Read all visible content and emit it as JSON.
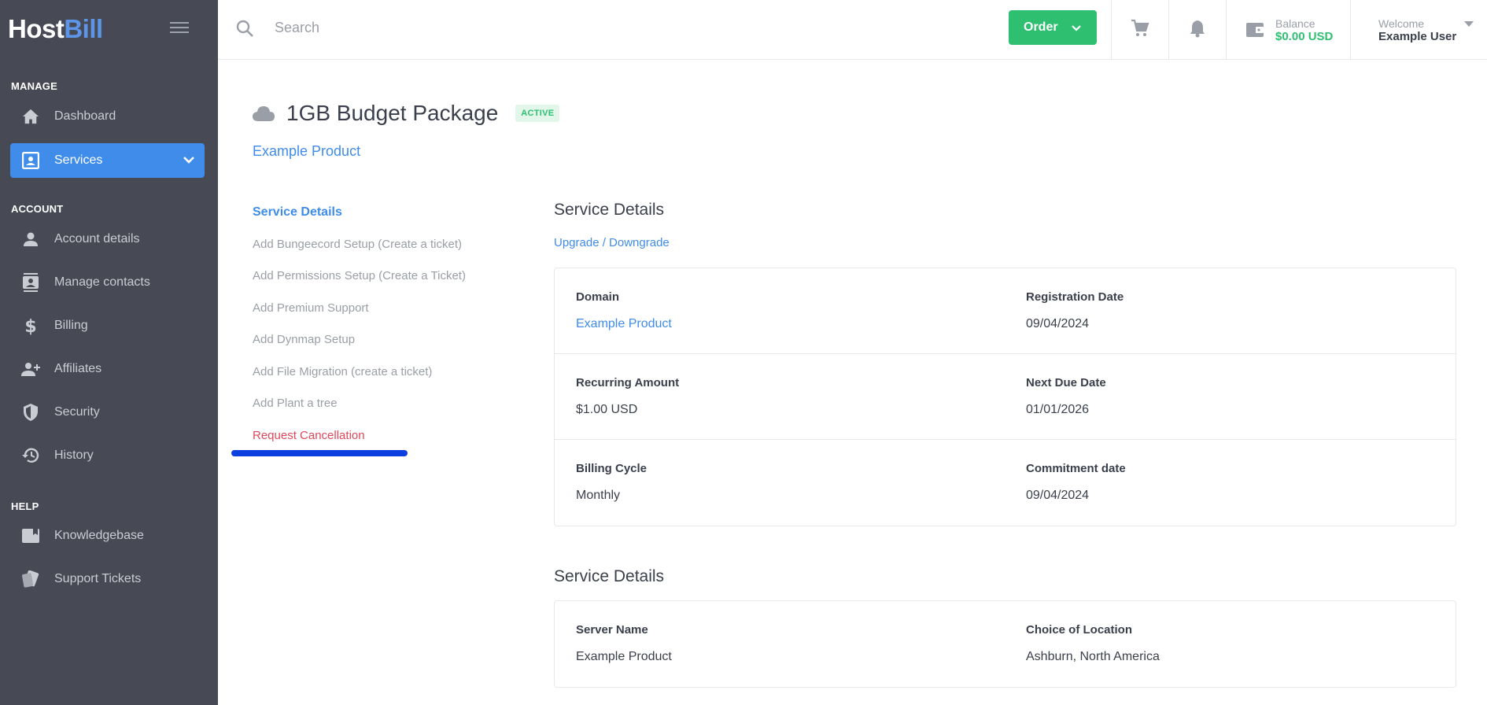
{
  "logo": {
    "host": "Host",
    "bill": "Bill"
  },
  "sidebar": {
    "sections": {
      "manage": "MANAGE",
      "account": "ACCOUNT",
      "help": "HELP"
    },
    "items": [
      {
        "label": "Dashboard",
        "icon": "home-icon"
      },
      {
        "label": "Services",
        "icon": "services-icon",
        "active": true
      },
      {
        "label": "Account details",
        "icon": "user-icon"
      },
      {
        "label": "Manage contacts",
        "icon": "contacts-icon"
      },
      {
        "label": "Billing",
        "icon": "dollar-icon"
      },
      {
        "label": "Affiliates",
        "icon": "affiliates-icon"
      },
      {
        "label": "Security",
        "icon": "shield-icon"
      },
      {
        "label": "History",
        "icon": "history-icon"
      },
      {
        "label": "Knowledgebase",
        "icon": "book-icon"
      },
      {
        "label": "Support Tickets",
        "icon": "tickets-icon"
      }
    ]
  },
  "topbar": {
    "search_placeholder": "Search",
    "order_label": "Order",
    "balance_label": "Balance",
    "balance_value": "$0.00 USD",
    "welcome_label": "Welcome",
    "user_name": "Example User"
  },
  "page": {
    "title": "1GB Budget Package",
    "status": "ACTIVE",
    "product_link": "Example Product"
  },
  "side_menu": [
    "Service Details",
    "Add Bungeecord Setup (Create a ticket)",
    "Add Permissions Setup (Create a Ticket)",
    "Add Premium Support",
    "Add Dynmap Setup",
    "Add File Migration (create a ticket)",
    "Add Plant a tree",
    "Request Cancellation"
  ],
  "details": {
    "title": "Service Details",
    "upgrade_link": "Upgrade / Downgrade",
    "rows": [
      {
        "l_label": "Domain",
        "l_value": "Example Product",
        "r_label": "Registration Date",
        "r_value": "09/04/2024"
      },
      {
        "l_label": "Recurring Amount",
        "l_value": "$1.00 USD",
        "r_label": "Next Due Date",
        "r_value": "01/01/2026"
      },
      {
        "l_label": "Billing Cycle",
        "l_value": "Monthly",
        "r_label": "Commitment date",
        "r_value": "09/04/2024"
      }
    ]
  },
  "details2": {
    "title": "Service Details",
    "rows": [
      {
        "l_label": "Server Name",
        "l_value": "Example Product",
        "r_label": "Choice of Location",
        "r_value": "Ashburn, North America"
      }
    ]
  },
  "colors": {
    "sidebar_bg": "#474a54",
    "accent": "#3f8cea",
    "success": "#2fbf71",
    "danger": "#e0485a"
  }
}
